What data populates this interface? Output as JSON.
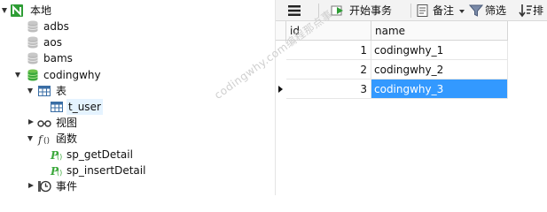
{
  "tree": {
    "root": {
      "label": "本地"
    },
    "databases": [
      {
        "label": "adbs"
      },
      {
        "label": "aos"
      },
      {
        "label": "bams"
      },
      {
        "label": "codingwhy"
      }
    ],
    "tables_group": {
      "label": "表"
    },
    "table_item": {
      "label": "t_user"
    },
    "views_group": {
      "label": "视图"
    },
    "functions_group": {
      "label": "函数"
    },
    "functions": [
      {
        "label": "sp_getDetail"
      },
      {
        "label": "sp_insertDetail"
      }
    ],
    "events_group": {
      "label": "事件"
    }
  },
  "toolbar": {
    "begin_transaction": "开始事务",
    "comment": "备注",
    "filter": "筛选",
    "sort": "排"
  },
  "grid": {
    "columns": [
      "id",
      "name"
    ],
    "rows": [
      {
        "id": "1",
        "name": "codingwhy_1"
      },
      {
        "id": "2",
        "name": "codingwhy_2"
      },
      {
        "id": "3",
        "name": "codingwhy_3"
      }
    ],
    "selected_row_index": 2
  },
  "watermark": "codingwhy.com编程那点事",
  "colors": {
    "selection": "#3399ff",
    "db_active": "#3aa83a"
  }
}
